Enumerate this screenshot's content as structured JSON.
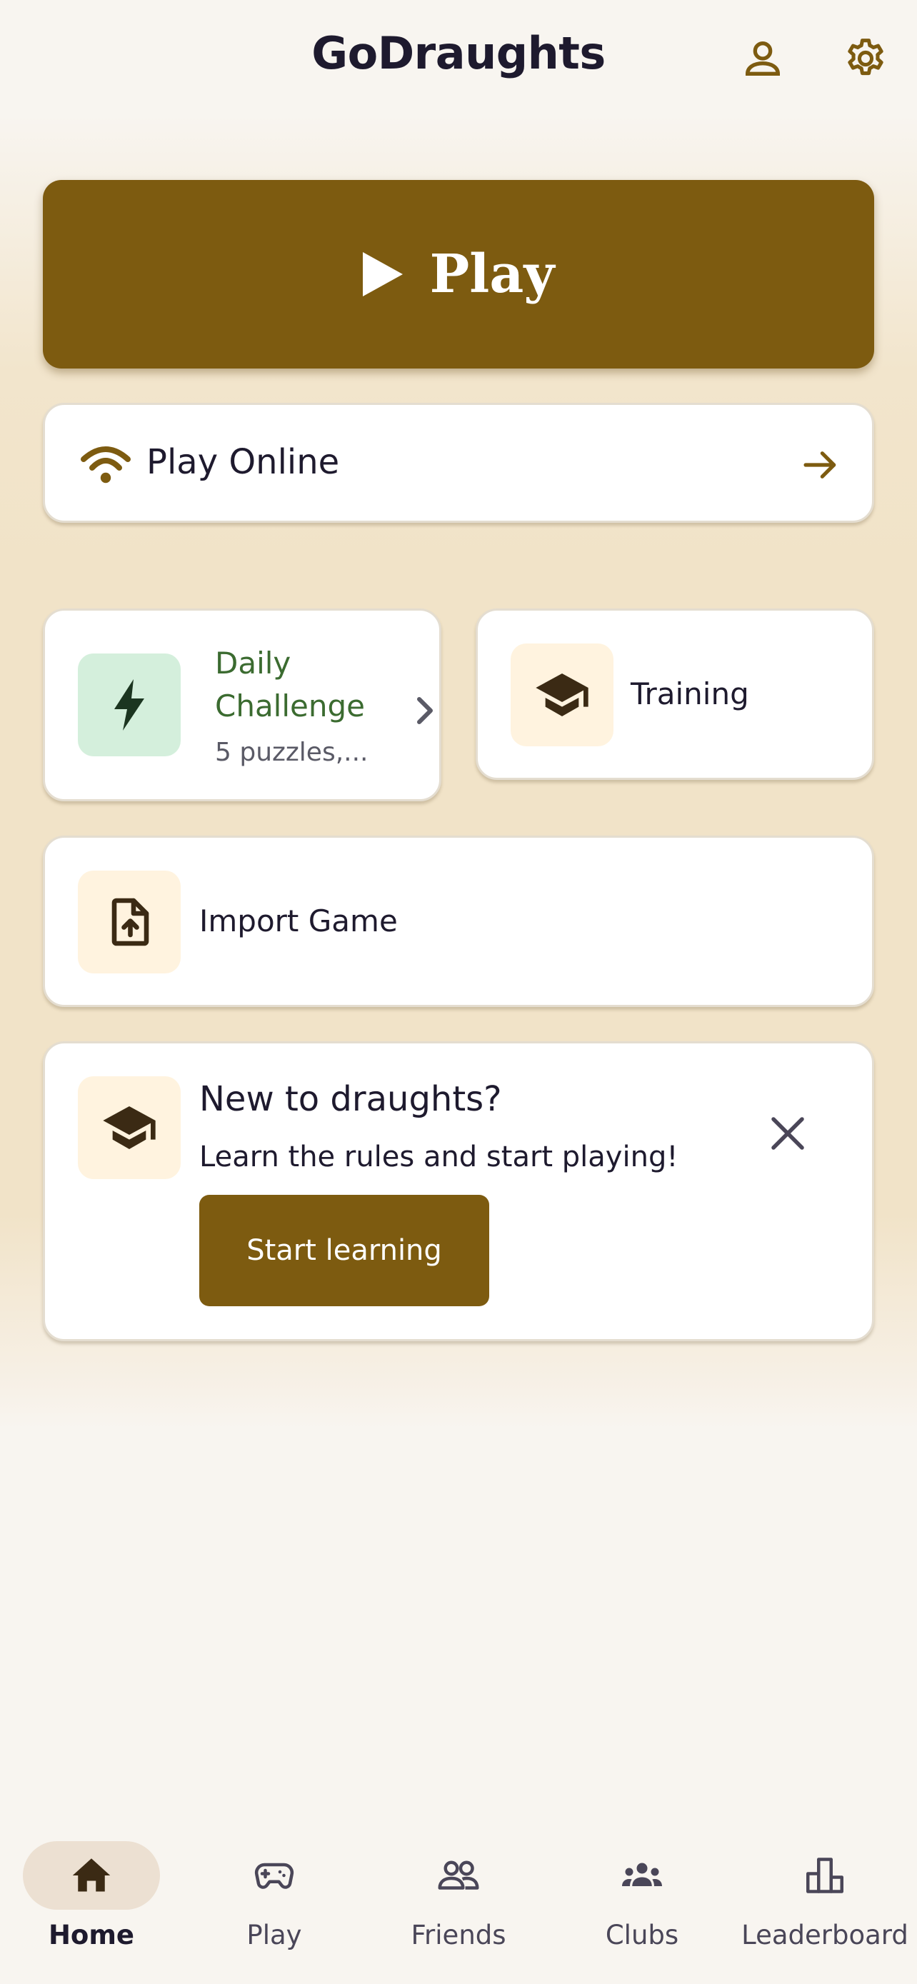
{
  "header": {
    "title": "GoDraughts",
    "profile_icon": "person-icon",
    "settings_icon": "gear-icon"
  },
  "play_hero": {
    "label": "Play",
    "icon": "play-icon"
  },
  "play_online": {
    "label": "Play Online",
    "icon": "wifi-icon",
    "trailing_icon": "arrow-right-icon"
  },
  "daily_challenge": {
    "title_line1": "Daily",
    "title_line2": "Challenge",
    "subtitle": "5 puzzles,...",
    "icon": "lightning-icon",
    "trailing_icon": "chevron-right-icon"
  },
  "training": {
    "label": "Training",
    "icon": "graduation-cap-icon"
  },
  "import_game": {
    "label": "Import Game",
    "icon": "file-upload-icon"
  },
  "new_player_card": {
    "title": "New to draughts?",
    "description": "Learn the rules and start playing!",
    "button_label": "Start learning",
    "icon": "graduation-cap-icon",
    "close_icon": "close-icon"
  },
  "bottom_nav": {
    "active": "Home",
    "items": [
      {
        "label": "Home",
        "icon": "home-icon"
      },
      {
        "label": "Play",
        "icon": "gamepad-icon"
      },
      {
        "label": "Friends",
        "icon": "friends-icon"
      },
      {
        "label": "Clubs",
        "icon": "group-icon"
      },
      {
        "label": "Leaderboard",
        "icon": "leaderboard-icon"
      }
    ]
  },
  "colors": {
    "brand": "#7d5b10",
    "text_primary": "#1e1a2e",
    "daily_green": "#3b6b30",
    "daily_tile": "#d4efdc",
    "tile_cream": "#fff3df",
    "nav_active_pill": "#ece0d2"
  }
}
